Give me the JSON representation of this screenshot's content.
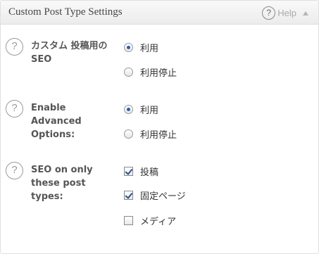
{
  "header": {
    "title": "Custom Post Type Settings",
    "help_label": "Help",
    "help_icon": "question-circle-icon",
    "collapse_icon": "triangle-up-icon"
  },
  "settings": [
    {
      "label": "カスタム 投稿用の SEO",
      "icon": "question-circle-icon",
      "type": "radio",
      "options": [
        {
          "label": "利用",
          "checked": true
        },
        {
          "label": "利用停止",
          "checked": false
        }
      ]
    },
    {
      "label": "Enable Advanced Options:",
      "icon": "question-circle-icon",
      "type": "radio",
      "options": [
        {
          "label": "利用",
          "checked": true
        },
        {
          "label": "利用停止",
          "checked": false
        }
      ]
    },
    {
      "label": "SEO on only these post types:",
      "icon": "question-circle-icon",
      "type": "checkbox",
      "options": [
        {
          "label": "投稿",
          "checked": true
        },
        {
          "label": "固定ページ",
          "checked": true
        },
        {
          "label": "メディア",
          "checked": false
        }
      ]
    }
  ],
  "colors": {
    "accent": "#2a5db0",
    "header_bg": "#ececec",
    "border": "#dfdfdf"
  }
}
